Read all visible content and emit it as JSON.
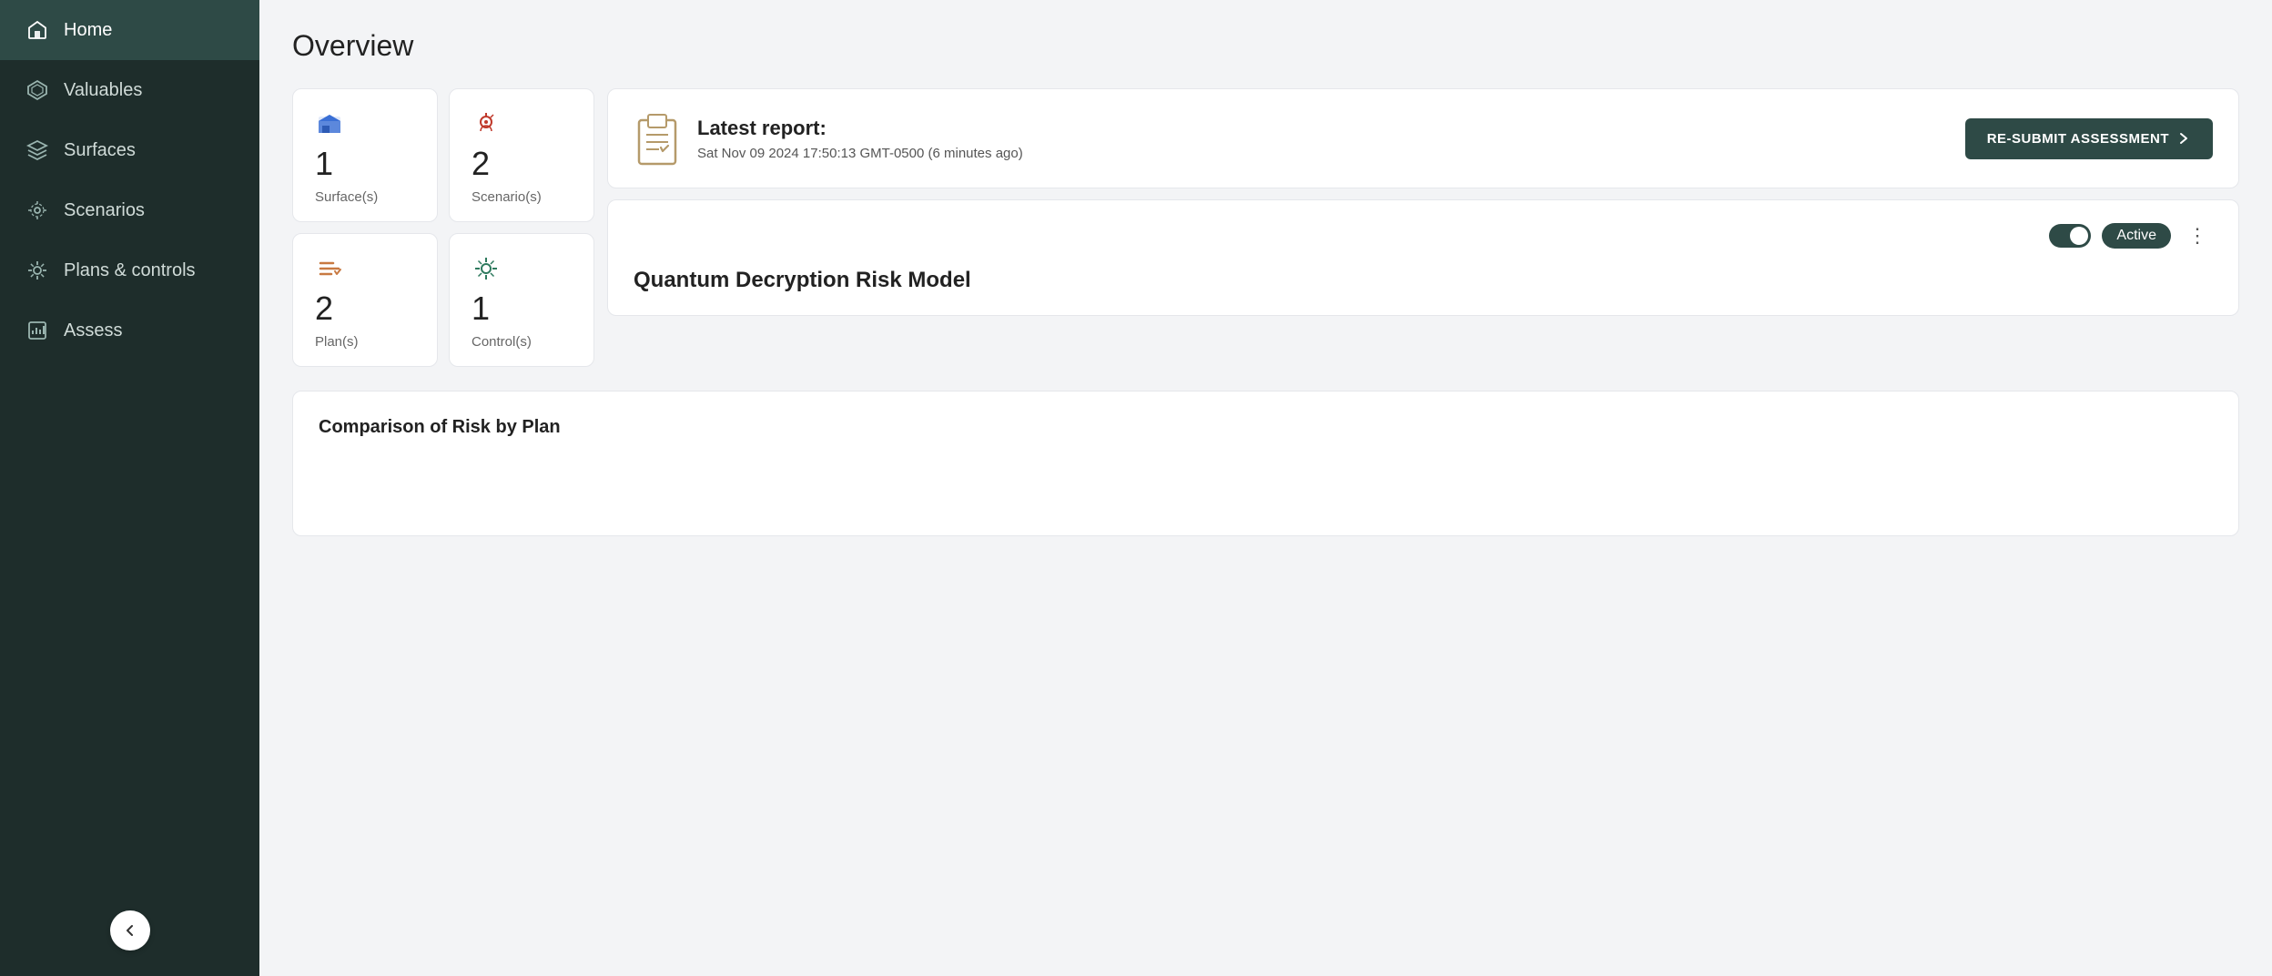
{
  "sidebar": {
    "items": [
      {
        "id": "home",
        "label": "Home",
        "active": true
      },
      {
        "id": "valuables",
        "label": "Valuables",
        "active": false
      },
      {
        "id": "surfaces",
        "label": "Surfaces",
        "active": false
      },
      {
        "id": "scenarios",
        "label": "Scenarios",
        "active": false
      },
      {
        "id": "plans-controls",
        "label": "Plans & controls",
        "active": false
      },
      {
        "id": "assess",
        "label": "Assess",
        "active": false
      }
    ],
    "collapse_label": "‹"
  },
  "main": {
    "page_title": "Overview",
    "stats": [
      {
        "id": "surfaces",
        "number": "1",
        "label": "Surface(s)"
      },
      {
        "id": "scenarios",
        "number": "2",
        "label": "Scenario(s)"
      },
      {
        "id": "plans",
        "number": "2",
        "label": "Plan(s)"
      },
      {
        "id": "controls",
        "number": "1",
        "label": "Control(s)"
      }
    ],
    "report_card": {
      "title": "Latest report:",
      "date": "Sat Nov 09 2024 17:50:13 GMT-0500  (6 minutes ago)",
      "resubmit_label": "RE-SUBMIT ASSESSMENT"
    },
    "model_card": {
      "active_badge": "Active",
      "model_name": "Quantum Decryption Risk Model"
    },
    "comparison_card": {
      "title": "Comparison of Risk by Plan"
    }
  },
  "colors": {
    "sidebar_bg": "#1e2d2b",
    "sidebar_active": "#2e4a46",
    "accent": "#2e4a46",
    "text_primary": "#222222",
    "text_secondary": "#666666"
  }
}
